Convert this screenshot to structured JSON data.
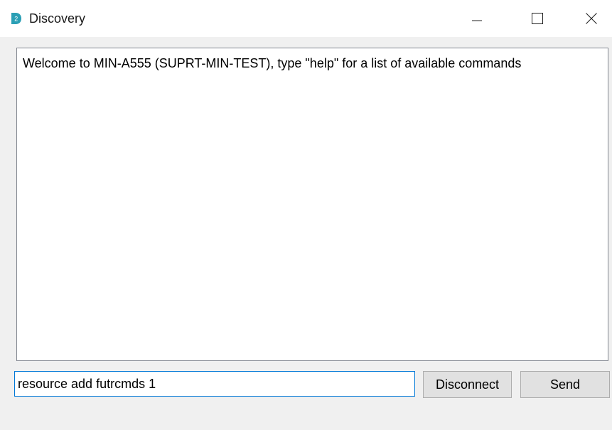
{
  "window": {
    "title": "Discovery",
    "icon": "discovery-app-icon",
    "controls": {
      "minimize_icon": "minimize-icon",
      "maximize_icon": "maximize-icon",
      "close_icon": "close-icon"
    }
  },
  "output": {
    "text": "Welcome to MIN-A555 (SUPRT-MIN-TEST), type \"help\" for a list of available commands"
  },
  "command": {
    "value": "resource add futrcmds 1"
  },
  "buttons": {
    "disconnect_label": "Disconnect",
    "send_label": "Send"
  },
  "colors": {
    "accent": "#0078d7",
    "icon_teal": "#2a9fb5",
    "window_bg": "#f0f0f0",
    "button_bg": "#e1e1e1"
  }
}
